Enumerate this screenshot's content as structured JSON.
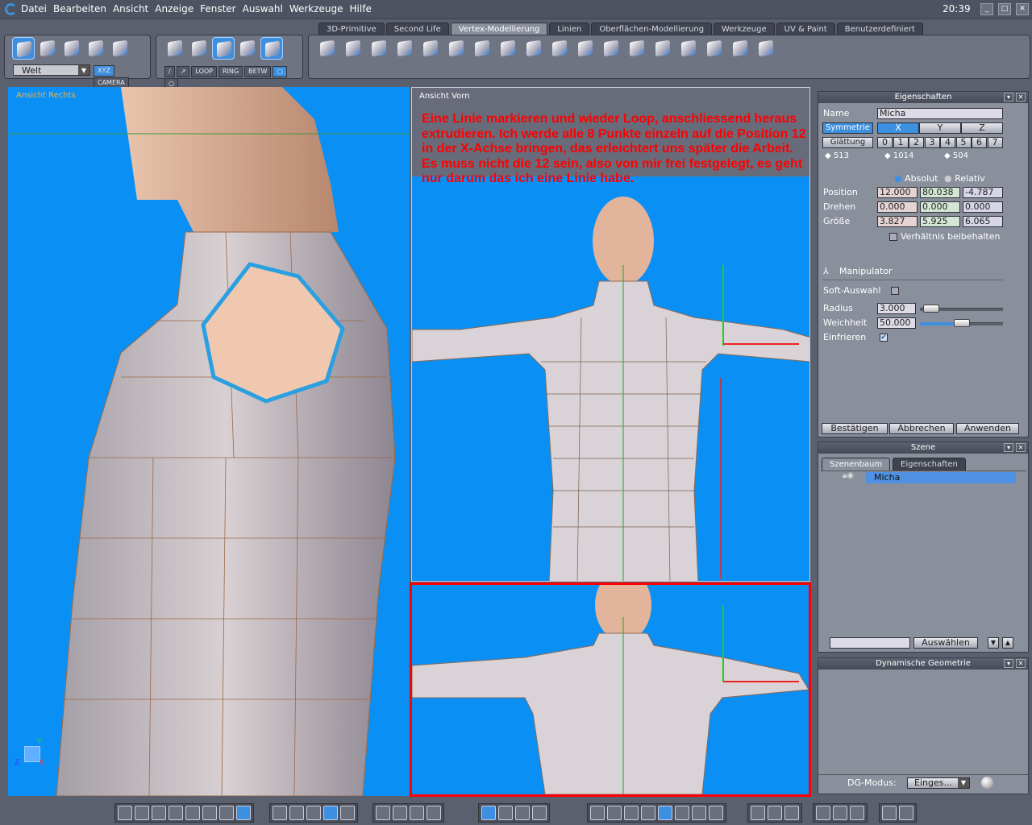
{
  "menu": {
    "items": [
      "Datei",
      "Bearbeiten",
      "Ansicht",
      "Anzeige",
      "Fenster",
      "Auswahl",
      "Werkzeuge",
      "Hilfe"
    ],
    "clock": "20:39"
  },
  "tabs": [
    "3D-Primitive",
    "Second Life",
    "Vertex-Modellierung",
    "Linien",
    "Oberflächen-Modellierung",
    "Werkzeuge",
    "UV & Paint",
    "Benutzerdefiniert"
  ],
  "toolbar": {
    "coord_select": "Welt",
    "xyz": "XYZ",
    "camera": "CAMERA",
    "loop": "LOOP",
    "ring": "RING",
    "betw": "BETW"
  },
  "views": {
    "left_label": "Ansicht Rechts",
    "front_label": "Ansicht Vorn",
    "annotation": "Eine Linie markieren und wieder Loop, anschliessend heraus extrudieren. Ich werde alle 8 Punkte einzeln auf die Position 12 in der X-Achse bringen, das erleichtert uns später die Arbeit. Es muss nicht die 12 sein, also von mir frei festgelegt, es geht nur darum das ich eine Linie habe.",
    "axis_y": "Y",
    "axis_z": "Z",
    "axis_x": "X"
  },
  "properties": {
    "title": "Eigenschaften",
    "name_label": "Name",
    "name_value": "Micha",
    "symmetrie": "Symmetrie",
    "sym_axes": [
      "X",
      "Y",
      "Z"
    ],
    "glaettung": "Glättung",
    "levels": [
      "0",
      "1",
      "2",
      "3",
      "4",
      "5",
      "6",
      "7"
    ],
    "counts": [
      "513",
      "1014",
      "504"
    ],
    "absolut": "Absolut",
    "relativ": "Relativ",
    "position_label": "Position",
    "position": [
      "12.000",
      "80.038",
      "-4.787"
    ],
    "drehen_label": "Drehen",
    "drehen": [
      "0.000",
      "0.000",
      "0.000"
    ],
    "groesse_label": "Größe",
    "groesse": [
      "3.827",
      "5.925",
      "6.065"
    ],
    "verhaeltnis": "Verhältnis beibehalten",
    "manipulator": "Manipulator",
    "soft": "Soft-Auswahl",
    "radius_label": "Radius",
    "radius": "3.000",
    "weichheit_label": "Weichheit",
    "weichheit": "50.000",
    "einfrieren": "Einfrieren",
    "radius_fraction": 0.05,
    "weichheit_fraction": 0.5,
    "bestaetigen": "Bestätigen",
    "abbrechen": "Abbrechen",
    "anwenden": "Anwenden"
  },
  "scene": {
    "title": "Szene",
    "tabs": [
      "Szenenbaum",
      "Eigenschaften"
    ],
    "item": "Micha",
    "auswaehlen": "Auswählen"
  },
  "dyn": {
    "title": "Dynamische Geometrie",
    "mode_label": "DG-Modus:",
    "mode_value": "Einges..."
  },
  "colors": {
    "accent": "#3d8fe0",
    "viewport": "#0a90f5",
    "annotation": "#ff0000"
  }
}
